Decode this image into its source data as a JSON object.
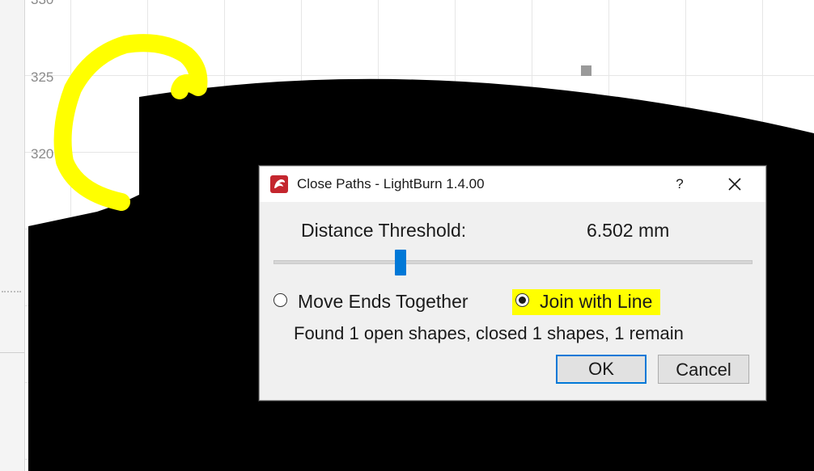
{
  "canvas": {
    "axis_labels": [
      "320",
      "325",
      "330"
    ]
  },
  "dialog": {
    "title": "Close Paths - LightBurn 1.4.00",
    "help_label": "?",
    "threshold_label": "Distance Threshold:",
    "threshold_value": "6.502 mm",
    "slider_level": 0.26,
    "options": {
      "move_ends_label": "Move Ends Together",
      "join_line_label": "Join with Line",
      "selected": "Join with Line"
    },
    "status": "Found 1 open shapes, closed 1 shapes, 1 remain",
    "ok_label": "OK",
    "cancel_label": "Cancel"
  },
  "colors": {
    "highlight": "#ffff00",
    "accent": "#0078d7",
    "shape": "#000000"
  }
}
